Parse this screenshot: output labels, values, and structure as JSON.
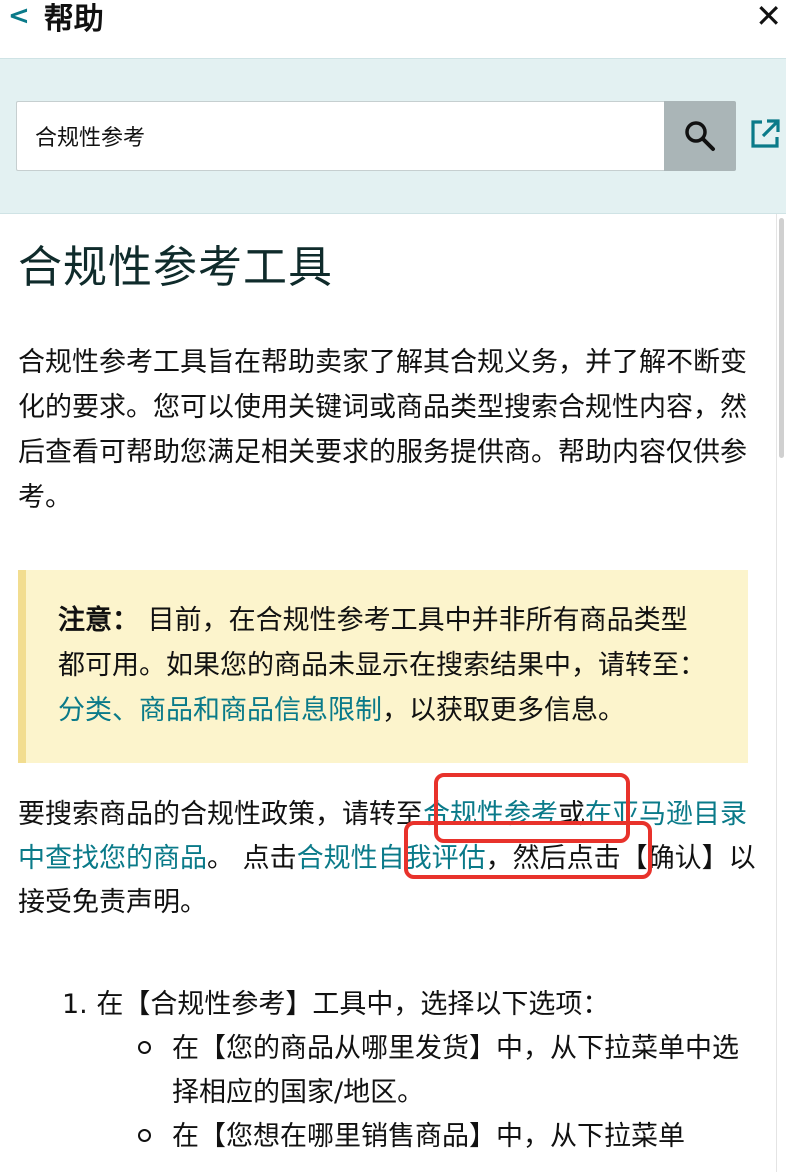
{
  "header": {
    "back_icon": "chevron-left-icon",
    "title": "帮助",
    "close_icon": "close-icon"
  },
  "search": {
    "value": "合规性参考",
    "search_icon": "magnifier-icon",
    "external_icon": "external-link-icon"
  },
  "article": {
    "title": "合规性参考工具",
    "intro": "合规性参考工具旨在帮助卖家了解其合规义务，并了解不断变化的要求。您可以使用关键词或商品类型搜索合规性内容，然后查看可帮助您满足相关要求的服务提供商。帮助内容仅供参考。",
    "note": {
      "label": "注意：",
      "text_before": " 目前，在合规性参考工具中并非所有商品类型都可用。如果您的商品未显示在搜索结果中，请转至： ",
      "link": "分类、商品和商品信息限制",
      "text_after": "，以获取更多信息。"
    },
    "para2": {
      "text1": "要搜索商品的合规性政策，请转至",
      "link1": "合规性参考",
      "text2": "或",
      "link2": "在亚马逊目录中查找您的商品",
      "text3": "。 点击",
      "link3": "合规性自我评估",
      "text4": "，然后点击【确认】以接受免责声明。"
    },
    "steps": [
      {
        "number": "1.",
        "text": "在【合规性参考】工具中，选择以下选项：",
        "sub": [
          "在【您的商品从哪里发货】中，从下拉菜单中选择相应的国家/地区。",
          "在【您想在哪里销售商品】中，从下拉菜单"
        ]
      }
    ]
  },
  "colors": {
    "link": "#0a7a89",
    "search_band": "#e3f1f2",
    "note_bg": "#fcf4cc",
    "note_border": "#f2dd90",
    "highlight": "#e8322b"
  }
}
